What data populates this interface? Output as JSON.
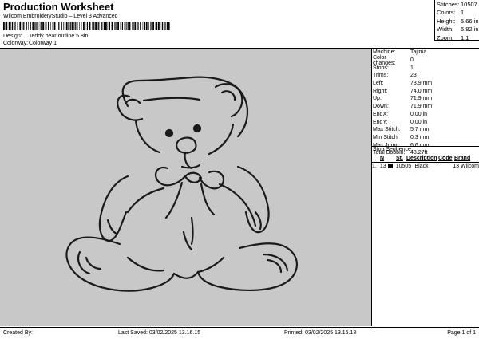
{
  "header": {
    "title": "Production Worksheet",
    "subtitle": "Wilcom EmbroideryStudio – Level 3 Advanced"
  },
  "meta": [
    {
      "label": "Design:",
      "value": "Teddy bear outline 5.8in"
    },
    {
      "label": "Colorway:",
      "value": "Colorway 1"
    }
  ],
  "stats": [
    {
      "label": "Stitches:",
      "value": "10507"
    },
    {
      "label": "Colors:",
      "value": "1"
    },
    {
      "label": "Height:",
      "value": "5.66 in"
    },
    {
      "label": "Width:",
      "value": "5.82 in"
    },
    {
      "label": "Zoom:",
      "value": "1:1"
    }
  ],
  "machine_info": [
    {
      "label": "Machine:",
      "value": "Tajima"
    },
    {
      "label": "Color changes:",
      "value": "0"
    },
    {
      "label": "Stops:",
      "value": "1"
    },
    {
      "label": "Trims:",
      "value": "23"
    },
    {
      "label": "Left:",
      "value": "73.9 mm"
    },
    {
      "label": "Right:",
      "value": "74.0 mm"
    },
    {
      "label": "Up:",
      "value": "71.9 mm"
    },
    {
      "label": "Down:",
      "value": "71.9 mm"
    },
    {
      "label": "EndX:",
      "value": "0.00 in"
    },
    {
      "label": "EndY:",
      "value": "0.00 in"
    },
    {
      "label": "Max Stitch:",
      "value": "5.7 mm"
    },
    {
      "label": "Min Stitch:",
      "value": "0.3 mm"
    },
    {
      "label": "Max Jump:",
      "value": "6.6 mm"
    },
    {
      "label": "Total Bobbin:",
      "value": "48.27ft"
    }
  ],
  "stop_sequence": {
    "title": "Stop Sequence:",
    "headers": [
      "N",
      "St.",
      "Description",
      "Code",
      "Brand"
    ],
    "rows": [
      {
        "index": "1.",
        "n": "13",
        "st": "10505",
        "description": "Black",
        "code": "13",
        "brand": "Wilcom",
        "color": "#000000"
      }
    ]
  },
  "footer": {
    "created_by": "Created By:",
    "last_saved": "Last Saved: 03/02/2025 13.16.15",
    "printed": "Printed: 03/02/2025 13.16.18",
    "page": "Page 1 of 1"
  },
  "colors": {
    "canvas_bg": "#c8c8c8",
    "thread": "#1a1a1a"
  }
}
